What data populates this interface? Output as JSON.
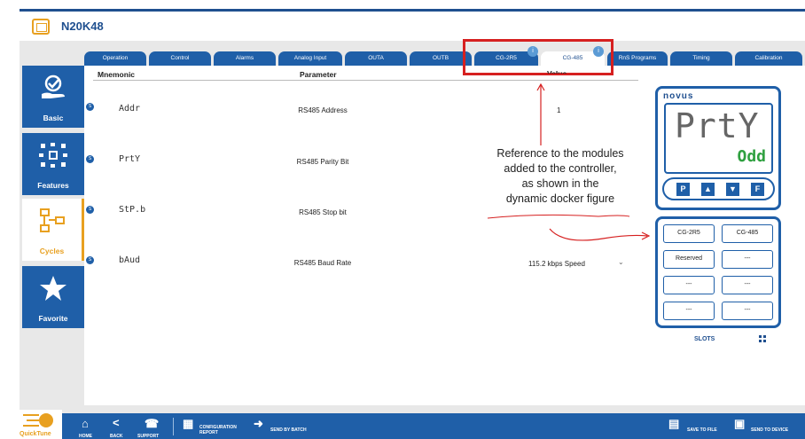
{
  "app": {
    "title": "N20K48"
  },
  "tabs": [
    {
      "label": "Operation"
    },
    {
      "label": "Control"
    },
    {
      "label": "Alarms"
    },
    {
      "label": "Analog Input"
    },
    {
      "label": "OUTA"
    },
    {
      "label": "OUTB"
    },
    {
      "label": "CG-2R5",
      "badge": "i"
    },
    {
      "label": "CG-485",
      "badge": "i",
      "active": true
    },
    {
      "label": "RnS Programs"
    },
    {
      "label": "Timing"
    },
    {
      "label": "Calibration"
    }
  ],
  "table": {
    "headers": {
      "mnemonic": "Mnemonic",
      "parameter": "Parameter",
      "value": "Value"
    },
    "rows": [
      {
        "badge": "S",
        "mnemonic": "Addr",
        "parameter": "RS485 Address",
        "value": "1"
      },
      {
        "badge": "S",
        "mnemonic": "PrtY",
        "parameter": "RS485 Parity Bit",
        "value": ""
      },
      {
        "badge": "S",
        "mnemonic": "StP.b",
        "parameter": "RS485 Stop bit",
        "value": ""
      },
      {
        "badge": "S",
        "mnemonic": "bAud",
        "parameter": "RS485 Baud Rate",
        "value": "115.2 kbps Speed"
      }
    ]
  },
  "sidenav": [
    {
      "label": "Basic",
      "icon": "hand-check-icon"
    },
    {
      "label": "Features",
      "icon": "network-icon"
    },
    {
      "label": "Cycles",
      "icon": "flowchart-icon",
      "active": true
    },
    {
      "label": "Favorite",
      "icon": "star-icon"
    }
  ],
  "annotation": {
    "lines": [
      "Reference to the modules",
      "added to the controller,",
      "as shown in the",
      "dynamic docker figure"
    ]
  },
  "device": {
    "brand": "novus",
    "display_main": "PrtY",
    "display_sub": "Odd",
    "keys": [
      "P",
      "▲",
      "▼",
      "F"
    ]
  },
  "slots": {
    "items": [
      "CG-2R5",
      "CG-485",
      "Reserved",
      "---",
      "---",
      "---",
      "---",
      "---"
    ],
    "label": "SLOTS"
  },
  "bottombar": {
    "home": "HOME",
    "back": "BACK",
    "support": "SUPPORT",
    "config_report": "CONFIGURATION REPORT",
    "send_batch": "SEND BY BATCH",
    "save_file": "SAVE TO FILE",
    "send_device": "SEND TO DEVICE",
    "brand": "QuickTune"
  },
  "colors": {
    "primary": "#1f5fa8",
    "accent": "#e8a020",
    "highlight": "#d62020",
    "lcd_green": "#2fa040"
  }
}
